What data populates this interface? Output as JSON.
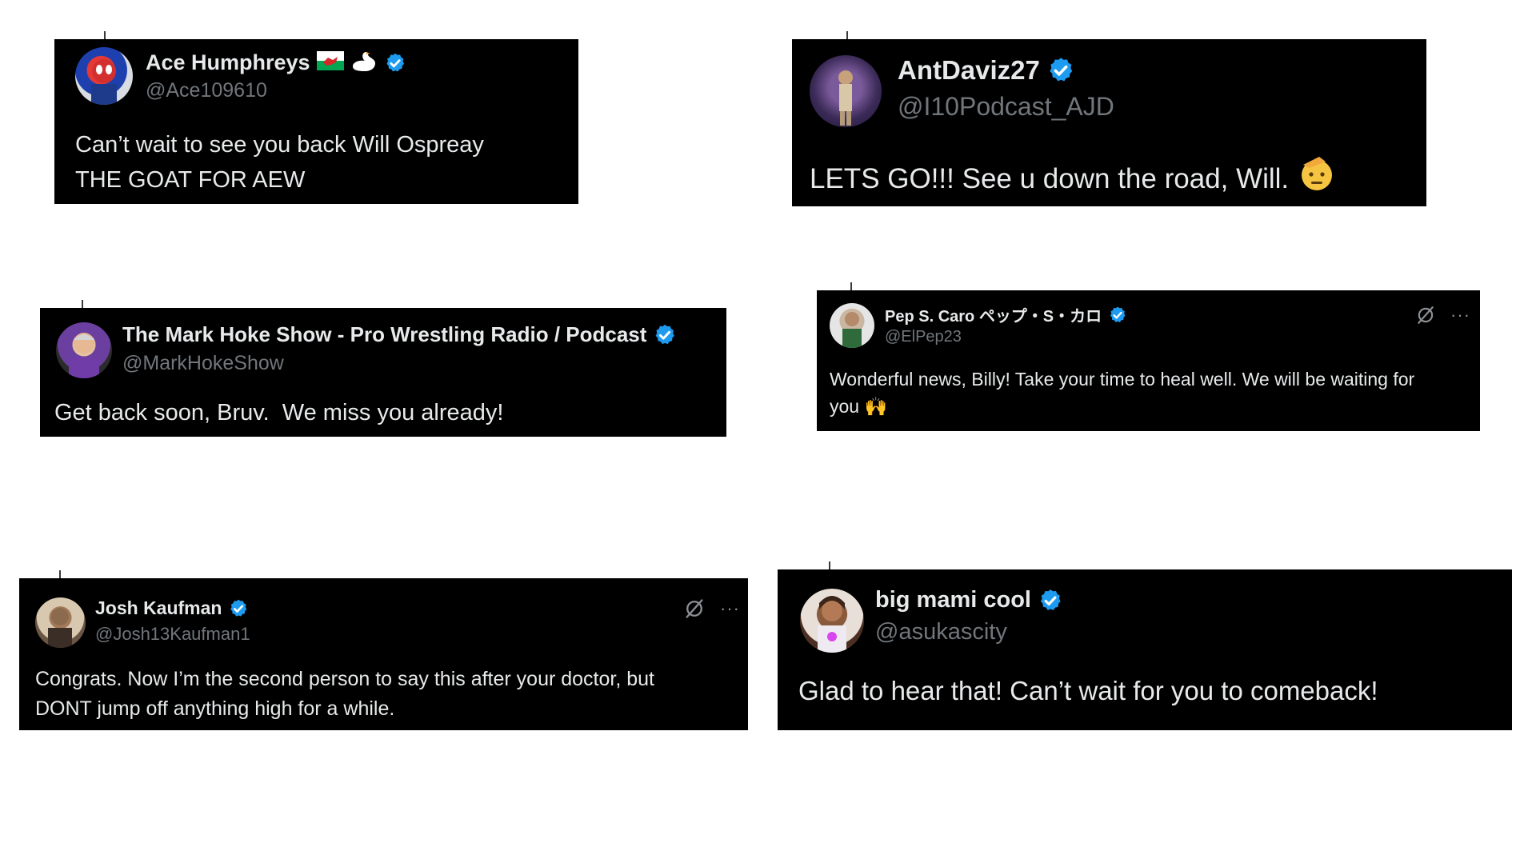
{
  "tweets": [
    {
      "name": "Ace Humphreys",
      "handle": "@Ace109610",
      "text_line1": "Can’t wait to see you back Will Ospreay",
      "text_line2": "THE GOAT FOR AEW",
      "icons": [
        "wales-flag-icon",
        "swan-icon",
        "verified-badge-icon"
      ]
    },
    {
      "name": "AntDaviz27",
      "handle": "@I10Podcast_AJD",
      "text": "LETS GO!!! See u down the road, Will.",
      "icons": [
        "verified-badge-icon",
        "saluting-face-emoji"
      ]
    },
    {
      "name": "The Mark Hoke Show - Pro Wrestling Radio / Podcast",
      "handle": "@MarkHokeShow",
      "text": "Get back soon, Bruv.  We miss you already!",
      "icons": [
        "verified-badge-icon"
      ]
    },
    {
      "name": "Pep S. Caro ペップ・S・カロ",
      "handle": "@ElPep23",
      "text_line1": "Wonderful news, Billy! Take your time to heal well. We will be waiting for",
      "text_line2": "you 🙌",
      "icons": [
        "verified-badge-icon",
        "grok-icon",
        "more-icon"
      ]
    },
    {
      "name": "Josh Kaufman",
      "handle": "@Josh13Kaufman1",
      "text_line1": "Congrats. Now I’m the second person to say this after your doctor, but",
      "text_line2": "DONT jump off anything high for a while.",
      "icons": [
        "verified-badge-icon",
        "grok-icon",
        "more-icon"
      ]
    },
    {
      "name": "big mami cool",
      "handle": "@asukascity",
      "text": "Glad to hear that! Can’t wait for you to comeback!",
      "icons": [
        "verified-badge-icon"
      ]
    }
  ],
  "colors": {
    "background": "#ffffff",
    "card": "#000000",
    "text": "#e7e9ea",
    "handle": "#71767b",
    "verified": "#1d9bf0"
  },
  "more_label": "···"
}
